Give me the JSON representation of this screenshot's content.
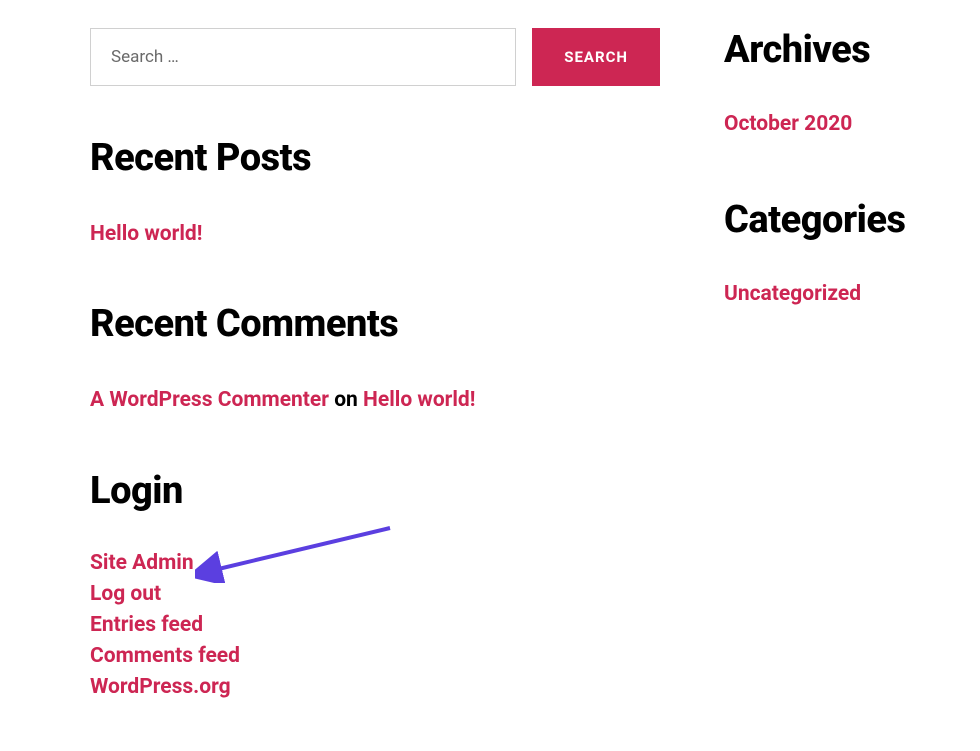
{
  "search": {
    "placeholder": "Search …",
    "button_label": "SEARCH"
  },
  "recent_posts": {
    "heading": "Recent Posts",
    "items": [
      "Hello world!"
    ]
  },
  "recent_comments": {
    "heading": "Recent Comments",
    "items": [
      {
        "author": "A WordPress Commenter",
        "on_text": "on",
        "post": "Hello world!"
      }
    ]
  },
  "login": {
    "heading": "Login",
    "items": [
      "Site Admin",
      "Log out",
      "Entries feed",
      "Comments feed",
      "WordPress.org"
    ]
  },
  "archives": {
    "heading": "Archives",
    "items": [
      "October 2020"
    ]
  },
  "categories": {
    "heading": "Categories",
    "items": [
      "Uncategorized"
    ]
  },
  "colors": {
    "accent": "#cd2653",
    "annotation_arrow": "#5b3fe0"
  }
}
